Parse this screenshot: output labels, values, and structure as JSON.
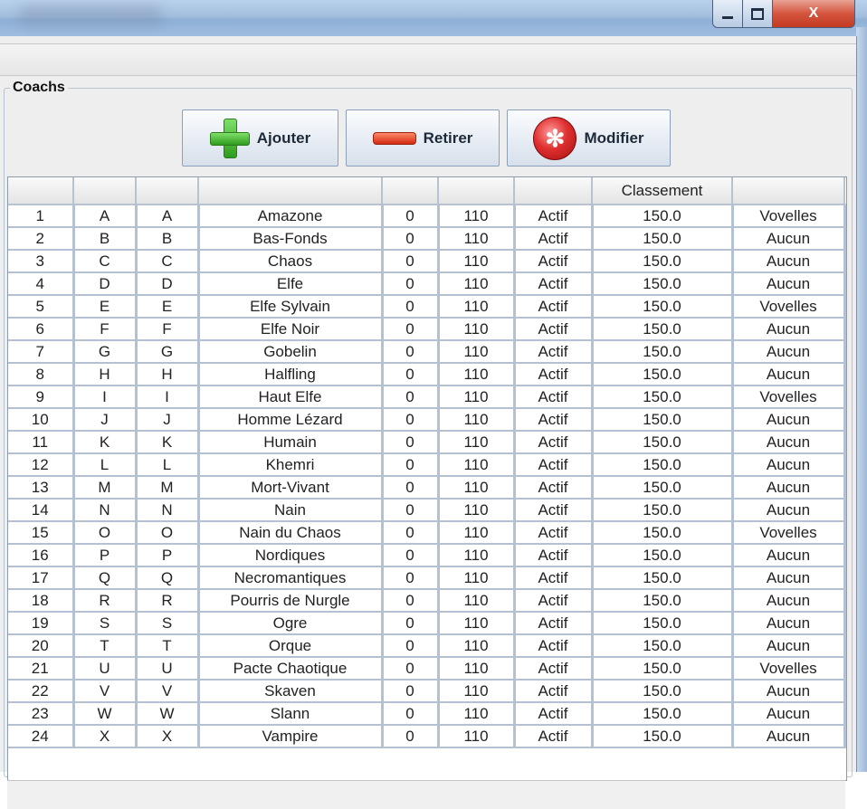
{
  "window": {
    "title": "",
    "controls": {
      "minimize_icon": "minimize-icon",
      "maximize_icon": "maximize-icon",
      "close_label": "X"
    }
  },
  "panel": {
    "title": "Coachs"
  },
  "buttons": {
    "add": {
      "label": "Ajouter",
      "icon": "plus-icon",
      "color": "#3fb02a"
    },
    "remove": {
      "label": "Retirer",
      "icon": "minus-icon",
      "color": "#e0421f"
    },
    "modify": {
      "label": "Modifier",
      "icon": "spider-icon",
      "color": "#d82828"
    }
  },
  "table": {
    "headers": [
      "",
      "",
      "",
      "",
      "",
      "",
      "",
      "Classement",
      ""
    ],
    "rows": [
      [
        "1",
        "A",
        "A",
        "Amazone",
        "0",
        "110",
        "Actif",
        "150.0",
        "Vovelles"
      ],
      [
        "2",
        "B",
        "B",
        "Bas-Fonds",
        "0",
        "110",
        "Actif",
        "150.0",
        "Aucun"
      ],
      [
        "3",
        "C",
        "C",
        "Chaos",
        "0",
        "110",
        "Actif",
        "150.0",
        "Aucun"
      ],
      [
        "4",
        "D",
        "D",
        "Elfe",
        "0",
        "110",
        "Actif",
        "150.0",
        "Aucun"
      ],
      [
        "5",
        "E",
        "E",
        "Elfe Sylvain",
        "0",
        "110",
        "Actif",
        "150.0",
        "Vovelles"
      ],
      [
        "6",
        "F",
        "F",
        "Elfe Noir",
        "0",
        "110",
        "Actif",
        "150.0",
        "Aucun"
      ],
      [
        "7",
        "G",
        "G",
        "Gobelin",
        "0",
        "110",
        "Actif",
        "150.0",
        "Aucun"
      ],
      [
        "8",
        "H",
        "H",
        "Halfling",
        "0",
        "110",
        "Actif",
        "150.0",
        "Aucun"
      ],
      [
        "9",
        "I",
        "I",
        "Haut Elfe",
        "0",
        "110",
        "Actif",
        "150.0",
        "Vovelles"
      ],
      [
        "10",
        "J",
        "J",
        "Homme Lézard",
        "0",
        "110",
        "Actif",
        "150.0",
        "Aucun"
      ],
      [
        "11",
        "K",
        "K",
        "Humain",
        "0",
        "110",
        "Actif",
        "150.0",
        "Aucun"
      ],
      [
        "12",
        "L",
        "L",
        "Khemri",
        "0",
        "110",
        "Actif",
        "150.0",
        "Aucun"
      ],
      [
        "13",
        "M",
        "M",
        "Mort-Vivant",
        "0",
        "110",
        "Actif",
        "150.0",
        "Aucun"
      ],
      [
        "14",
        "N",
        "N",
        "Nain",
        "0",
        "110",
        "Actif",
        "150.0",
        "Aucun"
      ],
      [
        "15",
        "O",
        "O",
        "Nain du Chaos",
        "0",
        "110",
        "Actif",
        "150.0",
        "Vovelles"
      ],
      [
        "16",
        "P",
        "P",
        "Nordiques",
        "0",
        "110",
        "Actif",
        "150.0",
        "Aucun"
      ],
      [
        "17",
        "Q",
        "Q",
        "Necromantiques",
        "0",
        "110",
        "Actif",
        "150.0",
        "Aucun"
      ],
      [
        "18",
        "R",
        "R",
        "Pourris de Nurgle",
        "0",
        "110",
        "Actif",
        "150.0",
        "Aucun"
      ],
      [
        "19",
        "S",
        "S",
        "Ogre",
        "0",
        "110",
        "Actif",
        "150.0",
        "Aucun"
      ],
      [
        "20",
        "T",
        "T",
        "Orque",
        "0",
        "110",
        "Actif",
        "150.0",
        "Aucun"
      ],
      [
        "21",
        "U",
        "U",
        "Pacte Chaotique",
        "0",
        "110",
        "Actif",
        "150.0",
        "Vovelles"
      ],
      [
        "22",
        "V",
        "V",
        "Skaven",
        "0",
        "110",
        "Actif",
        "150.0",
        "Aucun"
      ],
      [
        "23",
        "W",
        "W",
        "Slann",
        "0",
        "110",
        "Actif",
        "150.0",
        "Aucun"
      ],
      [
        "24",
        "X",
        "X",
        "Vampire",
        "0",
        "110",
        "Actif",
        "150.0",
        "Aucun"
      ]
    ]
  }
}
